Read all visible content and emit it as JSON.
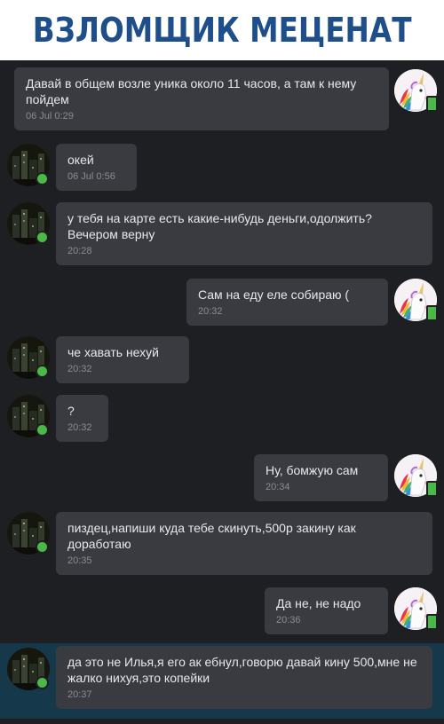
{
  "header": {
    "title": "ВЗЛОМЩИК МЕЦЕНАТ"
  },
  "colors": {
    "title": "#1f4f8a",
    "chat_bg": "#1e1f23",
    "bubble": "#3a3b41",
    "highlight": "#16384b",
    "online": "#4cb848"
  },
  "messages": [
    {
      "side": "right",
      "avatar": "unicorn-avatar",
      "text": "Давай в общем возле уника около 11 часов, а там к нему пойдем",
      "time": "06 Jul 0:29"
    },
    {
      "side": "left",
      "avatar": "dark-city-avatar",
      "text": "окей",
      "time": "06 Jul 0:56"
    },
    {
      "side": "left",
      "avatar": "dark-city-avatar",
      "text": "у тебя на карте есть какие-нибудь деньги,одолжить?Вечером верну",
      "time": "20:28"
    },
    {
      "side": "right",
      "avatar": "unicorn-avatar",
      "text": "Сам на еду еле собираю (",
      "time": "20:32"
    },
    {
      "side": "left",
      "avatar": "dark-city-avatar",
      "text": "че хавать нехуй",
      "time": "20:32"
    },
    {
      "side": "left",
      "avatar": "dark-city-avatar",
      "text": "?",
      "time": "20:32"
    },
    {
      "side": "right",
      "avatar": "unicorn-avatar",
      "text": "Ну, бомжую сам",
      "time": "20:34"
    },
    {
      "side": "left",
      "avatar": "dark-city-avatar",
      "text": "пиздец,напиши куда тебе скинуть,500р закину как доработаю",
      "time": "20:35"
    },
    {
      "side": "right",
      "avatar": "unicorn-avatar",
      "text": "Да не, не надо",
      "time": "20:36"
    },
    {
      "side": "left",
      "avatar": "dark-city-avatar",
      "text": "да это не Илья,я его ак ебнул,говорю давай кину 500,мне не жалко нихуя,это копейки",
      "time": "20:37",
      "highlighted": true
    }
  ]
}
